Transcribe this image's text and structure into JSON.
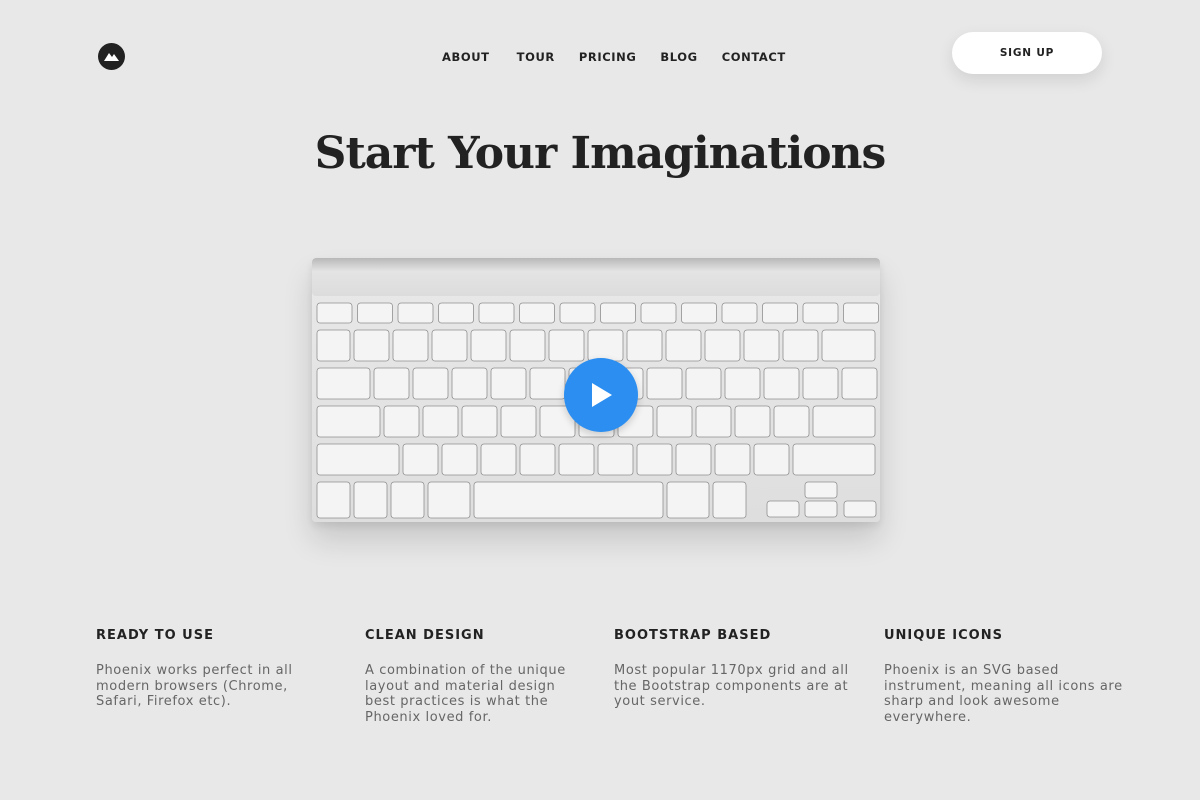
{
  "header": {
    "logo_icon": "mountain-logo-icon",
    "nav": [
      "ABOUT",
      "TOUR",
      "PRICING",
      "BLOG",
      "CONTACT"
    ],
    "signup_label": "SIGN UP"
  },
  "hero": {
    "title": "Start Your Imaginations",
    "play_icon": "play-icon",
    "accent_color": "#2b8ef0"
  },
  "features": [
    {
      "title": "READY TO USE",
      "text": "Phoenix works perfect in all modern browsers (Chrome, Safari, Firefox etc)."
    },
    {
      "title": "CLEAN DESIGN",
      "text": "A combination of the unique layout and material design best practices is what the Phoenix loved for."
    },
    {
      "title": "BOOTSTRAP BASED",
      "text": "Most popular 1170px grid and all the Bootstrap components are at yout service."
    },
    {
      "title": "UNIQUE ICONS",
      "text": "Phoenix is an SVG based instrument, meaning all icons are sharp and look awesome everywhere."
    }
  ]
}
